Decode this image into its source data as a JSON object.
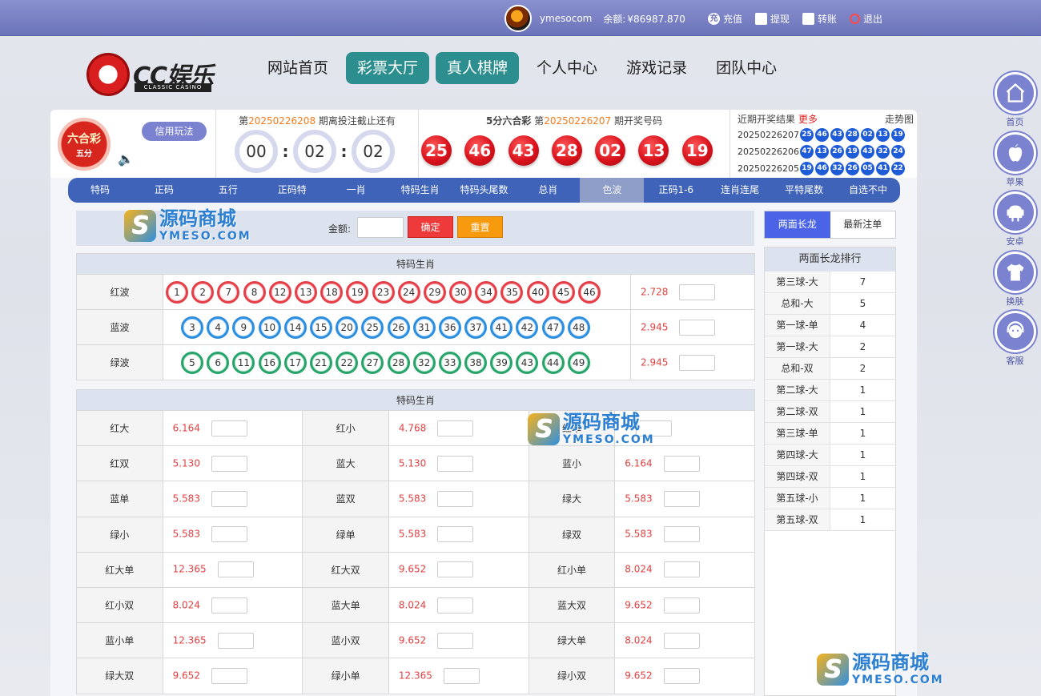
{
  "topbar": {
    "username": "ymesocom",
    "balance_label": "余额:",
    "balance_value": "¥86987.870",
    "links": [
      {
        "name": "recharge",
        "label": "充值",
        "icon": "charge-icon"
      },
      {
        "name": "withdraw",
        "label": "提现",
        "icon": "gift-icon"
      },
      {
        "name": "transfer",
        "label": "转账",
        "icon": "gift-icon"
      },
      {
        "name": "logout",
        "label": "退出",
        "icon": "power-icon"
      }
    ],
    "recharge_badge": "充"
  },
  "logo": {
    "brand": "CC娱乐",
    "tagline": "CLASSIC CASINO"
  },
  "nav": [
    "网站首页",
    "彩票大厅",
    "真人棋牌",
    "个人中心",
    "游戏记录",
    "团队中心"
  ],
  "nav_active": [
    "彩票大厅",
    "真人棋牌"
  ],
  "lottery": {
    "logo_main": "六合彩",
    "logo_sub": "五分",
    "credit_btn": "信用玩法",
    "period_prefix": "第",
    "current_period": "20250226208",
    "countdown_suffix": "期离投注截止还有",
    "countdown": [
      "00",
      "02",
      "02"
    ],
    "draw_name": "5分六合彩",
    "draw_prefix": "第",
    "draw_period": "20250226207",
    "draw_suffix": "期开奖号码",
    "draw_numbers": [
      "25",
      "46",
      "43",
      "28",
      "02",
      "13",
      "19"
    ]
  },
  "recent": {
    "title": "近期开奖结果",
    "more": "更多",
    "trend": "走势图",
    "rows": [
      {
        "id": "20250226207",
        "balls": [
          "25",
          "46",
          "43",
          "28",
          "02",
          "13",
          "19"
        ]
      },
      {
        "id": "20250226206",
        "balls": [
          "47",
          "13",
          "26",
          "19",
          "43",
          "32",
          "24"
        ]
      },
      {
        "id": "20250226205",
        "balls": [
          "19",
          "46",
          "32",
          "26",
          "05",
          "41",
          "22"
        ]
      }
    ]
  },
  "tabs": [
    "特码",
    "正码",
    "五行",
    "正码特",
    "一肖",
    "特码生肖",
    "特码头尾数",
    "总肖",
    "色波",
    "正码1-6",
    "连肖连尾",
    "平特尾数",
    "自选不中"
  ],
  "tab_active": "色波",
  "amount": {
    "label": "金额:",
    "ok": "确定",
    "reset": "重置"
  },
  "waves_table": {
    "title": "特码生肖",
    "rows": [
      {
        "label": "红波",
        "color": "red",
        "balls": [
          "1",
          "2",
          "7",
          "8",
          "12",
          "13",
          "18",
          "19",
          "23",
          "24",
          "29",
          "30",
          "34",
          "35",
          "40",
          "45",
          "46"
        ],
        "odds": "2.728"
      },
      {
        "label": "蓝波",
        "color": "blue",
        "balls": [
          "3",
          "4",
          "9",
          "10",
          "14",
          "15",
          "20",
          "25",
          "26",
          "31",
          "36",
          "37",
          "41",
          "42",
          "47",
          "48"
        ],
        "odds": "2.945"
      },
      {
        "label": "绿波",
        "color": "green",
        "balls": [
          "5",
          "6",
          "11",
          "16",
          "17",
          "21",
          "22",
          "27",
          "28",
          "32",
          "33",
          "38",
          "39",
          "43",
          "44",
          "49"
        ],
        "odds": "2.945"
      }
    ]
  },
  "half_table": {
    "title": "特码生肖",
    "rows": [
      [
        {
          "label": "红大",
          "odds": "6.164"
        },
        {
          "label": "红小",
          "odds": "4.768"
        },
        {
          "label": "红单",
          "odds": ""
        }
      ],
      [
        {
          "label": "红双",
          "odds": "5.130"
        },
        {
          "label": "蓝大",
          "odds": "5.130"
        },
        {
          "label": "蓝小",
          "odds": "6.164"
        }
      ],
      [
        {
          "label": "蓝单",
          "odds": "5.583"
        },
        {
          "label": "蓝双",
          "odds": "5.583"
        },
        {
          "label": "绿大",
          "odds": "5.583"
        }
      ],
      [
        {
          "label": "绿小",
          "odds": "5.583"
        },
        {
          "label": "绿单",
          "odds": "5.583"
        },
        {
          "label": "绿双",
          "odds": "5.583"
        }
      ],
      [
        {
          "label": "红大单",
          "odds": "12.365"
        },
        {
          "label": "红大双",
          "odds": "9.652"
        },
        {
          "label": "红小单",
          "odds": "8.024"
        }
      ],
      [
        {
          "label": "红小双",
          "odds": "8.024"
        },
        {
          "label": "蓝大单",
          "odds": "8.024"
        },
        {
          "label": "蓝大双",
          "odds": "9.652"
        }
      ],
      [
        {
          "label": "蓝小单",
          "odds": "12.365"
        },
        {
          "label": "蓝小双",
          "odds": "9.652"
        },
        {
          "label": "绿大单",
          "odds": "8.024"
        }
      ],
      [
        {
          "label": "绿大双",
          "odds": "9.652"
        },
        {
          "label": "绿小单",
          "odds": "12.365"
        },
        {
          "label": "绿小双",
          "odds": "9.652"
        }
      ]
    ]
  },
  "side": {
    "tabs": [
      "两面长龙",
      "最新注单"
    ],
    "active_tab": "两面长龙",
    "ranking_title": "两面长龙排行",
    "ranking": [
      {
        "name": "第三球-大",
        "value": "7"
      },
      {
        "name": "总和-大",
        "value": "5"
      },
      {
        "name": "第一球-单",
        "value": "4"
      },
      {
        "name": "第一球-大",
        "value": "2"
      },
      {
        "name": "总和-双",
        "value": "2"
      },
      {
        "name": "第二球-大",
        "value": "1"
      },
      {
        "name": "第二球-双",
        "value": "1"
      },
      {
        "name": "第三球-单",
        "value": "1"
      },
      {
        "name": "第四球-大",
        "value": "1"
      },
      {
        "name": "第四球-双",
        "value": "1"
      },
      {
        "name": "第五球-小",
        "value": "1"
      },
      {
        "name": "第五球-双",
        "value": "1"
      }
    ]
  },
  "float_icons": [
    {
      "label": "首页",
      "icon": "home-icon"
    },
    {
      "label": "苹果",
      "icon": "apple-icon"
    },
    {
      "label": "安卓",
      "icon": "android-icon"
    },
    {
      "label": "换肤",
      "icon": "shirt-icon"
    },
    {
      "label": "客服",
      "icon": "headset-icon"
    }
  ],
  "watermark": {
    "s": "S",
    "cn": "源码商城",
    "en": "YMESO.COM"
  },
  "colors": {
    "topbar": "#7a81c6",
    "nav_active": "#2c8e8e",
    "tab_bar": "#3f63b9",
    "draw_ball": "#d9121c",
    "mini_ball": "#1e5bd6",
    "odds": "#e24040",
    "ok_btn": "#ee3a3a",
    "reset_btn": "#f79a0e",
    "side_tab_active": "#4b63e6"
  }
}
